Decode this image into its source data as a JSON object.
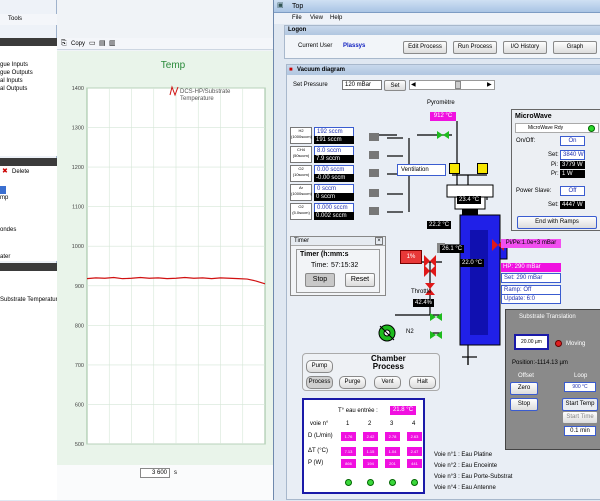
{
  "left_window": {
    "menu": {
      "tools": "Tools"
    },
    "tree_items": [
      "gue Inputs",
      "gue Outputs",
      "al Inputs",
      "al Outputs"
    ],
    "mid_panel": {
      "delete_label": "Delete",
      "items": [
        "mp",
        "ondes",
        "ater"
      ]
    },
    "bottom_panel": {
      "item": "Substrate Temperatur"
    }
  },
  "chart_window": {
    "toolbar": {
      "copy_label": "Copy"
    },
    "zoom_value": "3 600",
    "zoom_unit": "s"
  },
  "chart_data": {
    "type": "line",
    "title": "Temp",
    "yticks": [
      1400,
      1300,
      1200,
      1100,
      1000,
      900,
      800,
      700,
      600,
      500
    ],
    "ylim": [
      500,
      1400
    ],
    "xlim": [
      0,
      100
    ],
    "series": [
      {
        "name": "DCS-HP/Substrate Temperature",
        "color": "#d01010",
        "x": [
          0,
          5,
          10,
          15,
          20,
          25,
          30,
          35,
          40,
          45,
          50,
          55,
          60,
          65,
          70,
          75,
          80,
          85,
          90,
          95,
          100
        ],
        "values": [
          918,
          920,
          919,
          921,
          918,
          919,
          921,
          919,
          920,
          918,
          919,
          921,
          919,
          920,
          918,
          920,
          919,
          918,
          917,
          912,
          905
        ]
      }
    ]
  },
  "top_window": {
    "title": "Top",
    "menu": [
      "File",
      "View",
      "Help"
    ],
    "logon": {
      "title": "Logon",
      "current_user_label": "Current User",
      "current_user": "Plassys",
      "buttons": [
        "Edit Process",
        "Run Process",
        "I/O History",
        "Graph"
      ]
    },
    "vacuum": {
      "title": "Vacuum diagram",
      "set_pressure_label": "Set Pressure",
      "set_pressure_value": "120 mBar",
      "set_button": "Set",
      "pyrometre_label": "Pyromètre",
      "pyrometre_value": "912 °C",
      "gases": [
        {
          "name": "H2",
          "range": "(1000sccm)",
          "set": "192 sccm",
          "read": "191 sccm"
        },
        {
          "name": "CH4",
          "range": "(50sccm)",
          "set": "8.0 sccm",
          "read": "7.9 sccm"
        },
        {
          "name": "O2",
          "range": "(10sccm)",
          "set": "0.00 sccm",
          "read": "-0.00 sccm"
        },
        {
          "name": "Ar",
          "range": "(1000sccm)",
          "set": "0 sccm",
          "read": "0 sccm"
        },
        {
          "name": "O2",
          "range": "(5.0sccm)",
          "set": "0.000 sccm",
          "read": "0.002 sccm"
        }
      ],
      "ventilation_label": "Ventilation",
      "temps": {
        "t1": "23.4 °C",
        "t2": "22.2 °C",
        "t3": "26.1 °C",
        "t4": "22.0 °C"
      },
      "throttle_label": "Throttle",
      "throttle_value": "42.4%",
      "n2_label": "N2",
      "valve_pct": "1%",
      "pi_pe": "Pi/Pe:1.0e+3 mBar",
      "hp": {
        "reading": "HP: 290 mBar",
        "set": "Set: 290 mBar",
        "ramp": "Ramp: Off",
        "update": "Update: 6:0"
      }
    },
    "microwave": {
      "title": "MicroWave",
      "rdy_label": "MicroWave Rdy",
      "onoff_label": "On/Off:",
      "onoff_value": "On",
      "set_label": "Set:",
      "set_value": "3840 W",
      "pi_label": "Pi:",
      "pi_value": "3779 W",
      "pr_label": "Pr:",
      "pr_value": "1 W",
      "power_slave_label": "Power Slave:",
      "power_slave_value": "Off",
      "slave_set_label": "Set:",
      "slave_set_value": "4447 W",
      "end_ramps_button": "End with Ramps"
    },
    "timer": {
      "title": "Timer",
      "subtitle": "Timer (h:mm:s",
      "time_label": "Time:",
      "time_value": "57:15:32",
      "stop": "Stop",
      "reset": "Reset"
    },
    "chamber": {
      "title_line1": "Chamber",
      "title_line2": "Process",
      "buttons": [
        "Pump",
        "Process",
        "Purge",
        "Vent",
        "Halt"
      ]
    },
    "water": {
      "inlet_label": "T° eau entrée :",
      "inlet_value": "21.8 °C",
      "voie_label": "voie n°",
      "voies": [
        "1",
        "2",
        "3",
        "4"
      ],
      "rows": [
        {
          "label": "D (L/min)",
          "values": [
            "1.76",
            "2.42",
            "2.78",
            "2.63"
          ]
        },
        {
          "label": "ΔT (°C)",
          "values": [
            "7.13",
            "1.15",
            "1.04",
            "2.47"
          ]
        },
        {
          "label": "P (W)",
          "values": [
            "866",
            "194",
            "201",
            "441"
          ]
        }
      ],
      "legend": [
        "Voie n°1 : Eau Platine",
        "Voie n°2 : Eau Enceinte",
        "Voie n°3 : Eau Porte-Substrat",
        "Voie n°4 : Eau Antenne"
      ]
    },
    "substrate": {
      "title": "Substrate Translation",
      "pos_value": "20.00 µm",
      "moving_label": "Moving",
      "position": "Position:-1114.13 µm",
      "offset_label": "Offset",
      "loop_label": "Loop",
      "zero_button": "Zero",
      "loop_value": "900 °C",
      "stop_button": "Stop",
      "start_temp_button": "Start Temp",
      "start_time_button": "Start Time",
      "time_value": "0.1 min"
    }
  }
}
